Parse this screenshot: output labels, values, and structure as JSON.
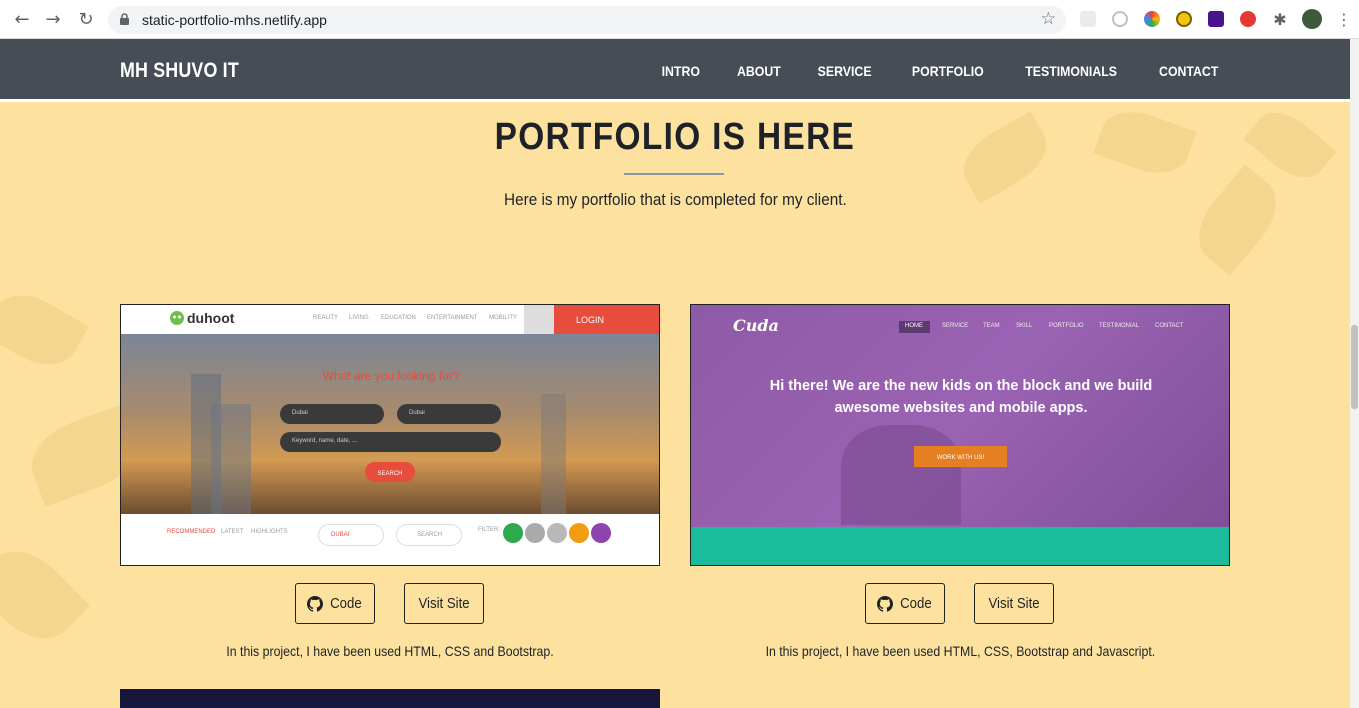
{
  "browser": {
    "url": "static-portfolio-mhs.netlify.app"
  },
  "navbar": {
    "brand": "MH SHUVO IT",
    "links": [
      "INTRO",
      "ABOUT",
      "SERVICE",
      "PORTFOLIO",
      "TESTIMONIALS",
      "CONTACT"
    ]
  },
  "section": {
    "title": "PORTFOLIO IS HERE",
    "subtitle": "Here is my portfolio that is completed for my client."
  },
  "projects": [
    {
      "preview": {
        "logo": "duhoot",
        "menu": [
          "REALITY",
          "LIVING",
          "EDUCATION",
          "ENTERTAINMENT",
          "MOBILITY"
        ],
        "login": "LOGIN",
        "headline": "What are you looking for?",
        "select_1": "Dubai",
        "select_2": "Dubai",
        "search_placeholder": "Keyword, name, date, ...",
        "search_button": "SEARCH",
        "tabs": [
          "RECOMMENDED",
          "LATEST",
          "HIGHLIGHTS"
        ],
        "city": "DUBAI",
        "mini_search": "SEARCH",
        "filter": "FILTER:"
      },
      "code_label": "Code",
      "visit_label": "Visit Site",
      "description": "In this project, I have been used HTML, CSS and Bootstrap."
    },
    {
      "preview": {
        "logo": "Cuda",
        "menu": [
          "HOME",
          "SERVICE",
          "TEAM",
          "SKILL",
          "PORTFOLIO",
          "TESTIMONIAL",
          "CONTACT"
        ],
        "headline": "Hi there! We are the new kids on the block and we build awesome websites and mobile apps.",
        "cta": "WORK WITH US!"
      },
      "code_label": "Code",
      "visit_label": "Visit Site",
      "description": "In this project, I have been used HTML, CSS, Bootstrap and Javascript."
    }
  ],
  "colors": {
    "background": "#fde19f",
    "navbar": "#474d54",
    "duhoot_accent": "#e74c3c",
    "cuda_purple": "#8e5aa6",
    "cuda_teal": "#1abc9c"
  },
  "icons": [
    "back-icon",
    "forward-icon",
    "reload-icon",
    "lock-icon",
    "bookmark-star-icon",
    "github-icon",
    "extensions-icon",
    "menu-kebab-icon"
  ]
}
